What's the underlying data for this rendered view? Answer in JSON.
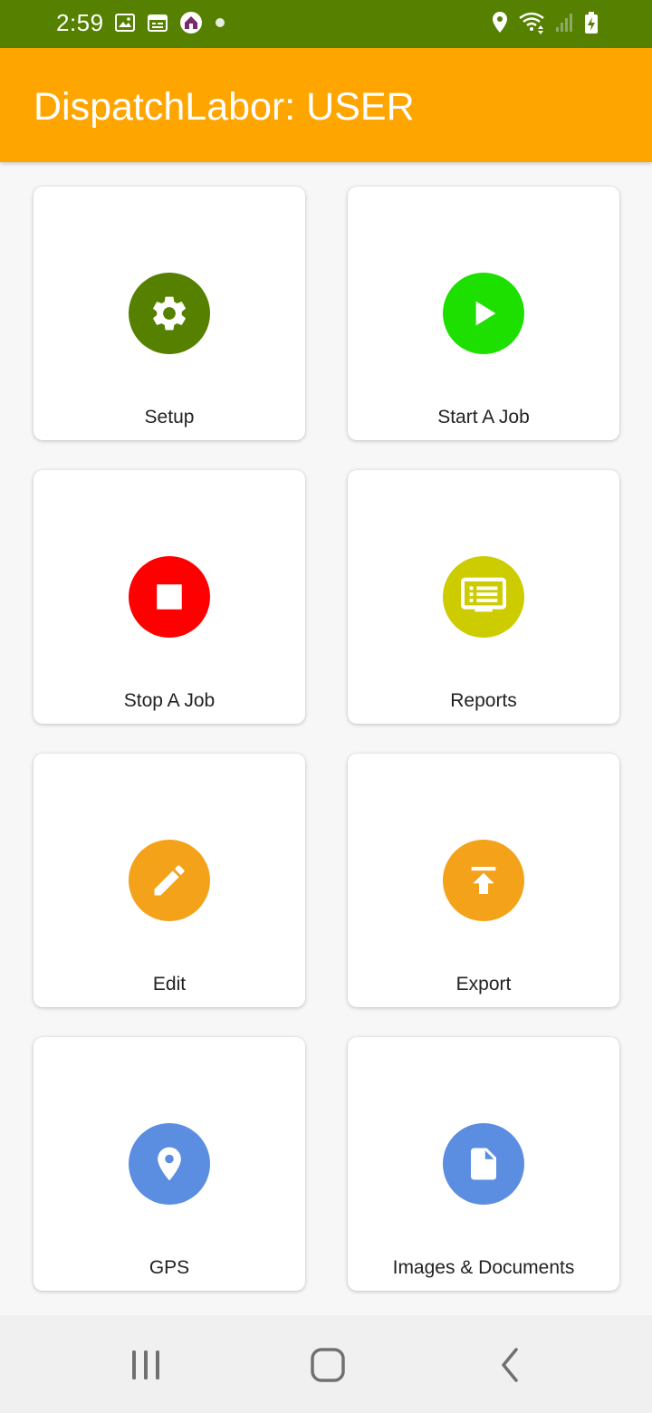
{
  "status_bar": {
    "time": "2:59",
    "left_icons": [
      "gallery-icon",
      "calendar-icon",
      "app-notification-icon",
      "dot-icon"
    ],
    "right_icons": [
      "location-icon",
      "wifi-icon",
      "signal-icon",
      "battery-charging-icon"
    ],
    "background": "#558000"
  },
  "app_bar": {
    "title": "DispatchLabor: USER",
    "background": "#ffa500"
  },
  "tiles": [
    {
      "label": "Setup",
      "icon": "gear-icon",
      "color": "#558000"
    },
    {
      "label": "Start A Job",
      "icon": "play-icon",
      "color": "#1ee000"
    },
    {
      "label": "Stop A Job",
      "icon": "stop-icon",
      "color": "#ff0000"
    },
    {
      "label": "Reports",
      "icon": "monitor-list-icon",
      "color": "#cccc00"
    },
    {
      "label": "Edit",
      "icon": "pencil-icon",
      "color": "#f4a21a"
    },
    {
      "label": "Export",
      "icon": "upload-icon",
      "color": "#f4a21a"
    },
    {
      "label": "GPS",
      "icon": "location-pin-icon",
      "color": "#5b8de0"
    },
    {
      "label": "Images & Documents",
      "icon": "document-icon",
      "color": "#5b8de0"
    }
  ],
  "nav_bar": {
    "buttons": [
      "recent-apps-icon",
      "home-icon",
      "back-icon"
    ]
  }
}
